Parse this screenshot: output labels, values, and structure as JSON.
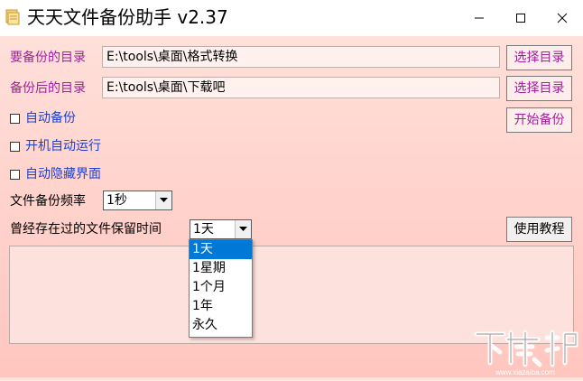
{
  "window": {
    "title": "天天文件备份助手 v2.37"
  },
  "source_dir": {
    "label": "要备份的目录",
    "value": "E:\\tools\\桌面\\格式转换",
    "button": "选择目录"
  },
  "target_dir": {
    "label": "备份后的目录",
    "value": "E:\\tools\\桌面\\下载吧",
    "button": "选择目录"
  },
  "start_button": "开始备份",
  "options": [
    {
      "label": "自动备份",
      "checked": false
    },
    {
      "label": "开机自动运行",
      "checked": false
    },
    {
      "label": "自动隐藏界面",
      "checked": false
    }
  ],
  "frequency": {
    "label": "文件备份频率",
    "value": "1秒"
  },
  "retention": {
    "label": "曾经存在过的文件保留时间",
    "value": "1天",
    "options": [
      "1天",
      "1星期",
      "1个月",
      "1年",
      "永久"
    ],
    "highlighted": "1天"
  },
  "tutorial_button": "使用教程",
  "watermark": {
    "text": "下载吧",
    "sub": "www.xiazaiba.com"
  },
  "colors": {
    "accent_purple": "#a0229b",
    "accent_blue": "#1f3fd0",
    "selection": "#0078d7"
  }
}
